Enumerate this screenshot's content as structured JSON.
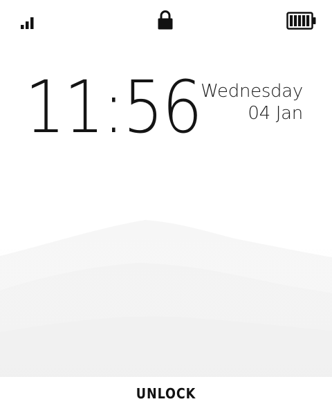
{
  "status_bar": {
    "signal_icon": "signal-bars-icon",
    "signal_bars": 3,
    "lock_icon": "padlock-icon",
    "battery_icon": "battery-full-icon",
    "battery_level": 1.0
  },
  "lockscreen": {
    "time": "11:56",
    "weekday": "Wednesday",
    "date": "04 Jan"
  },
  "unlock": {
    "label": "UNLOCK"
  },
  "colors": {
    "background": "#ffffff",
    "text": "#111111",
    "wallpaper_mist": "#eeeeee"
  }
}
